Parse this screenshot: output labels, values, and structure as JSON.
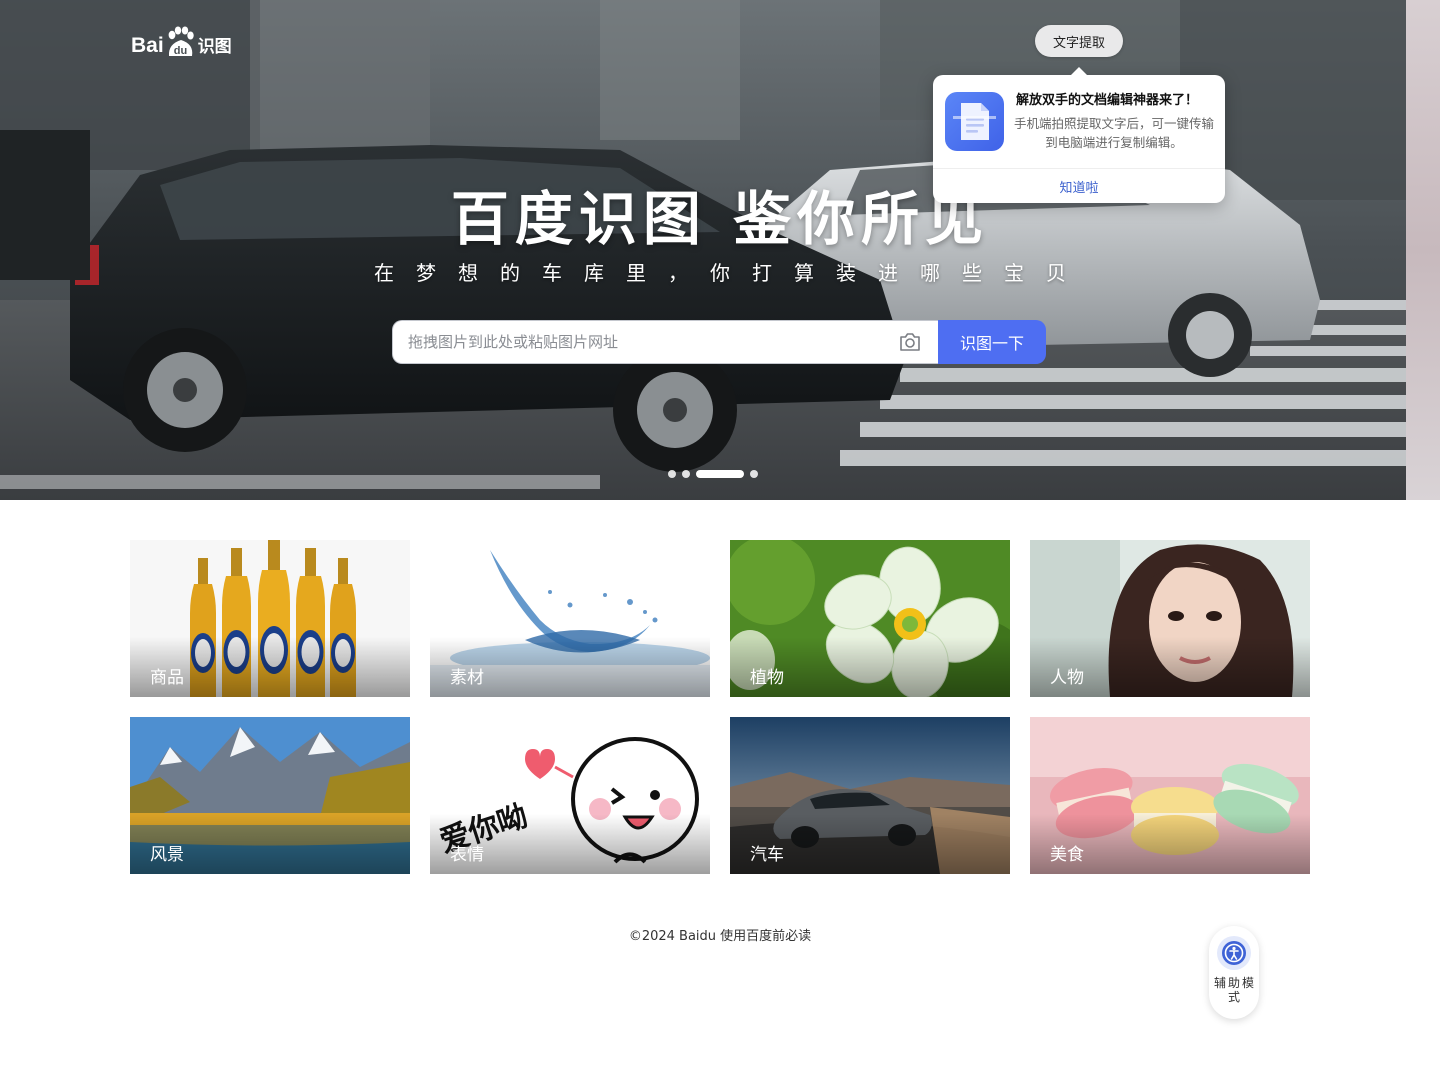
{
  "logo": {
    "bai": "Bai",
    "du": "du",
    "product": "识图"
  },
  "hero": {
    "title": "百度识图 鉴你所见",
    "subtitle": "在梦想的车库里，你打算装进哪些宝贝",
    "search_placeholder": "拖拽图片到此处或粘贴图片网址",
    "search_value": "",
    "search_button": "识图一下",
    "slide_count": 4,
    "active_slide": 3
  },
  "text_extract": {
    "chip_label": "文字提取",
    "popup_title": "解放双手的文档编辑神器来了！",
    "popup_desc": "手机端拍照提取文字后，可一键传输到电脑端进行复制编辑。",
    "popup_ok": "知道啦"
  },
  "categories": [
    {
      "label": "商品",
      "icon": "beer-bottles"
    },
    {
      "label": "素材",
      "icon": "water-splash"
    },
    {
      "label": "植物",
      "icon": "flower"
    },
    {
      "label": "人物",
      "icon": "portrait"
    },
    {
      "label": "风景",
      "icon": "mountain-lake"
    },
    {
      "label": "表情",
      "icon": "emoji-sticker"
    },
    {
      "label": "汽车",
      "icon": "sports-car"
    },
    {
      "label": "美食",
      "icon": "macarons"
    }
  ],
  "footer": {
    "copyright": "©2024 Baidu",
    "terms": "使用百度前必读"
  },
  "assist": {
    "label": "辅助模式"
  },
  "colors": {
    "accent": "#4e6ef2",
    "link": "#3a5fcd"
  }
}
